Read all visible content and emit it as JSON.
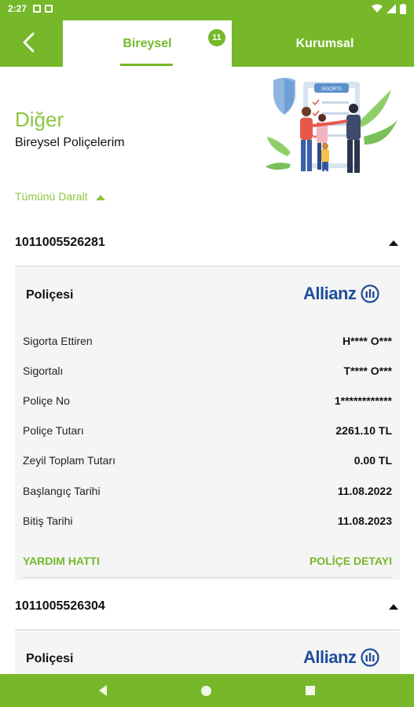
{
  "status_bar": {
    "time": "2:27"
  },
  "header": {
    "tab_bireysel": "Bireysel",
    "tab_kurumsal": "Kurumsal",
    "badge_count": "11"
  },
  "page": {
    "title": "Diğer",
    "subtitle": "Bireysel Poliçelerim",
    "collapse_all": "Tümünü Daralt"
  },
  "illustration": {
    "sign_text": "SİGORTA"
  },
  "policies": [
    {
      "number": "1011005526281",
      "title": "Poliçesi",
      "insurer": "Allianz",
      "rows": [
        {
          "label": "Sigorta Ettiren",
          "value": "H**** O***"
        },
        {
          "label": "Sigortalı",
          "value": "T**** O***"
        },
        {
          "label": "Poliçe No",
          "value": "1************"
        },
        {
          "label": "Poliçe Tutarı",
          "value": "2261.10 TL"
        },
        {
          "label": "Zeyil Toplam Tutarı",
          "value": "0.00 TL"
        },
        {
          "label": "Başlangıç Tarihi",
          "value": "11.08.2022"
        },
        {
          "label": "Bitiş Tarihi",
          "value": "11.08.2023"
        }
      ],
      "help_line": "YARDIM HATTI",
      "details": "POLİÇE DETAYI"
    },
    {
      "number": "1011005526304",
      "title": "Poliçesi",
      "insurer": "Allianz"
    }
  ],
  "colors": {
    "brand_green": "#76b82a",
    "light_green": "#8cc63f",
    "allianz_blue": "#1f4e9a"
  }
}
